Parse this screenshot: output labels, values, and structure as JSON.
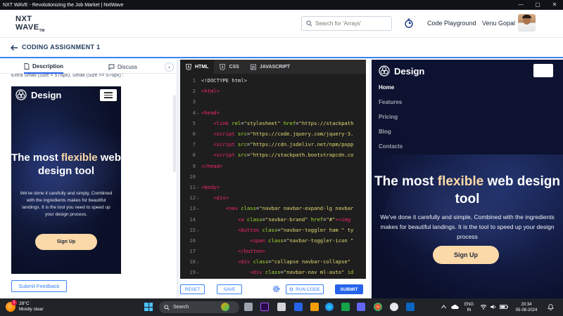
{
  "window": {
    "title": "NXT WAVE - Revolutionizing the Job Market | NxtWave",
    "controls": [
      "—",
      "▢",
      "✕"
    ]
  },
  "header": {
    "logo_line1": "NXT",
    "logo_line2": "WAVE",
    "logo_tm": "TM",
    "search_placeholder": "Search for 'Arrays'",
    "code_playground": "Code Playground",
    "user_name": "Venu Gopal"
  },
  "subheader": {
    "title": "CODING ASSIGNMENT 1"
  },
  "left_panel": {
    "tabs": [
      {
        "label": "Description"
      },
      {
        "label": "Discuss"
      }
    ],
    "collapse": "‹",
    "cut_text": "Extra Small (Size < 576px), Small (Size >= 576px) :",
    "feedback_button": "Submit Feedback",
    "mini_preview": {
      "brand": "Design",
      "heading_pre": "The most ",
      "heading_highlight": "flexible",
      "heading_post": " web design tool",
      "description": "We've done it carefully and simply, Combined with the ingredients makes for beautiful landings. It is the tool you need to speed up your design process.",
      "button": "Sign Up"
    }
  },
  "editor": {
    "tabs": [
      {
        "label": "HTML"
      },
      {
        "label": "CSS"
      },
      {
        "label": "JAVASCRIPT"
      }
    ],
    "lines": [
      {
        "n": "1",
        "fold": "",
        "html": "<span class='doctype'>&lt;!DOCTYPE html&gt;</span>"
      },
      {
        "n": "2",
        "fold": "",
        "html": "<span class='tag'>&lt;html&gt;</span>"
      },
      {
        "n": "3",
        "fold": "",
        "html": ""
      },
      {
        "n": "4",
        "fold": "⌄",
        "html": "<span class='tag'>&lt;head&gt;</span>"
      },
      {
        "n": "5",
        "fold": "",
        "html": "&nbsp;&nbsp;&nbsp;&nbsp;<span class='tag'>&lt;link</span> <span class='attr'>rel</span>=<span class='str'>\"stylesheet\"</span> <span class='attr'>href</span>=<span class='str'>\"https://stackpath</span>"
      },
      {
        "n": "6",
        "fold": "",
        "html": "&nbsp;&nbsp;&nbsp;&nbsp;<span class='tag'>&lt;script</span> <span class='attr'>src</span>=<span class='str'>\"https://code.jquery.com/jquery-3.</span>"
      },
      {
        "n": "7",
        "fold": "",
        "html": "&nbsp;&nbsp;&nbsp;&nbsp;<span class='tag'>&lt;script</span> <span class='attr'>src</span>=<span class='str'>\"https://cdn.jsdelivr.net/npm/popp</span>"
      },
      {
        "n": "8",
        "fold": "",
        "html": "&nbsp;&nbsp;&nbsp;&nbsp;<span class='tag'>&lt;script</span> <span class='attr'>src</span>=<span class='str'>\"https://stackpath.bootstrapcdn.co</span>"
      },
      {
        "n": "9",
        "fold": "",
        "html": "<span class='tag'>&lt;/head&gt;</span>"
      },
      {
        "n": "10",
        "fold": "",
        "html": ""
      },
      {
        "n": "11",
        "fold": "⌄",
        "html": "<span class='tag'>&lt;body&gt;</span>"
      },
      {
        "n": "12",
        "fold": "⌄",
        "html": "&nbsp;&nbsp;&nbsp;&nbsp;<span class='tag'>&lt;div&gt;</span>"
      },
      {
        "n": "13",
        "fold": "⌄",
        "html": "&nbsp;&nbsp;&nbsp;&nbsp;&nbsp;&nbsp;&nbsp;&nbsp;<span class='tag'>&lt;nav</span> <span class='attr'>class</span>=<span class='str'>\"navbar navbar-expand-lg navbar</span>"
      },
      {
        "n": "14",
        "fold": "",
        "html": "&nbsp;&nbsp;&nbsp;&nbsp;&nbsp;&nbsp;&nbsp;&nbsp;&nbsp;&nbsp;&nbsp;&nbsp;<span class='tag'>&lt;a</span> <span class='attr'>class</span>=<span class='str'>\"navbar-brand\"</span> <span class='attr'>href</span>=<span class='str'>\"#\"</span><span class='tag'>&gt;&lt;img</span>"
      },
      {
        "n": "15",
        "fold": "⌄",
        "html": "&nbsp;&nbsp;&nbsp;&nbsp;&nbsp;&nbsp;&nbsp;&nbsp;&nbsp;&nbsp;&nbsp;&nbsp;<span class='tag'>&lt;button</span> <span class='attr'>class</span>=<span class='str'>\"navbar-toggler ham \" ty</span>"
      },
      {
        "n": "16",
        "fold": "",
        "html": "&nbsp;&nbsp;&nbsp;&nbsp;&nbsp;&nbsp;&nbsp;&nbsp;&nbsp;&nbsp;&nbsp;&nbsp;&nbsp;&nbsp;&nbsp;&nbsp;<span class='tag'>&lt;span</span> <span class='attr'>class</span>=<span class='str'>\"navbar-toggler-icon \"</span>"
      },
      {
        "n": "17",
        "fold": "",
        "html": "&nbsp;&nbsp;&nbsp;&nbsp;&nbsp;&nbsp;&nbsp;&nbsp;&nbsp;&nbsp;&nbsp;&nbsp;<span class='tag'>&lt;/button&gt;</span>"
      },
      {
        "n": "18",
        "fold": "⌄",
        "html": "&nbsp;&nbsp;&nbsp;&nbsp;&nbsp;&nbsp;&nbsp;&nbsp;&nbsp;&nbsp;&nbsp;&nbsp;<span class='tag'>&lt;div</span> <span class='attr'>class</span>=<span class='str'>\"collapse navbar-collapse\"</span>"
      },
      {
        "n": "19",
        "fold": "⌄",
        "html": "&nbsp;&nbsp;&nbsp;&nbsp;&nbsp;&nbsp;&nbsp;&nbsp;&nbsp;&nbsp;&nbsp;&nbsp;&nbsp;&nbsp;&nbsp;&nbsp;<span class='tag'>&lt;div</span> <span class='attr'>class</span>=<span class='str'>\"navbar-nav ml-auto\"</span> <span class='attr'>id</span>"
      }
    ],
    "reset": "RESET",
    "save": "SAVE",
    "run": "RUN CODE",
    "submit": "SUBMIT"
  },
  "preview": {
    "brand": "Design",
    "links": [
      {
        "label": "Home"
      },
      {
        "label": "Features"
      },
      {
        "label": "Pricing"
      },
      {
        "label": "Blog"
      },
      {
        "label": "Contacts"
      }
    ],
    "heading_pre": "The most ",
    "heading_highlight": "flexible",
    "heading_post": " web design tool",
    "description": "We've done it carefully and simple, Combined with the ingredients makes for beautiful landings. It is the tool to speed up your design process",
    "button": "Sign Up"
  },
  "taskbar": {
    "weather_temp": "28°C",
    "weather_desc": "Mostly clear",
    "weather_badge": "1",
    "search": "Search",
    "lang1": "ENG",
    "lang2": "IN",
    "time": "20:34",
    "date": "05-08-2024"
  },
  "colors": {
    "accent": "#2563eb",
    "highlight": "#fcd9a8",
    "preview_bg": "#0d1230",
    "editor_bg": "#1e1e1e"
  }
}
